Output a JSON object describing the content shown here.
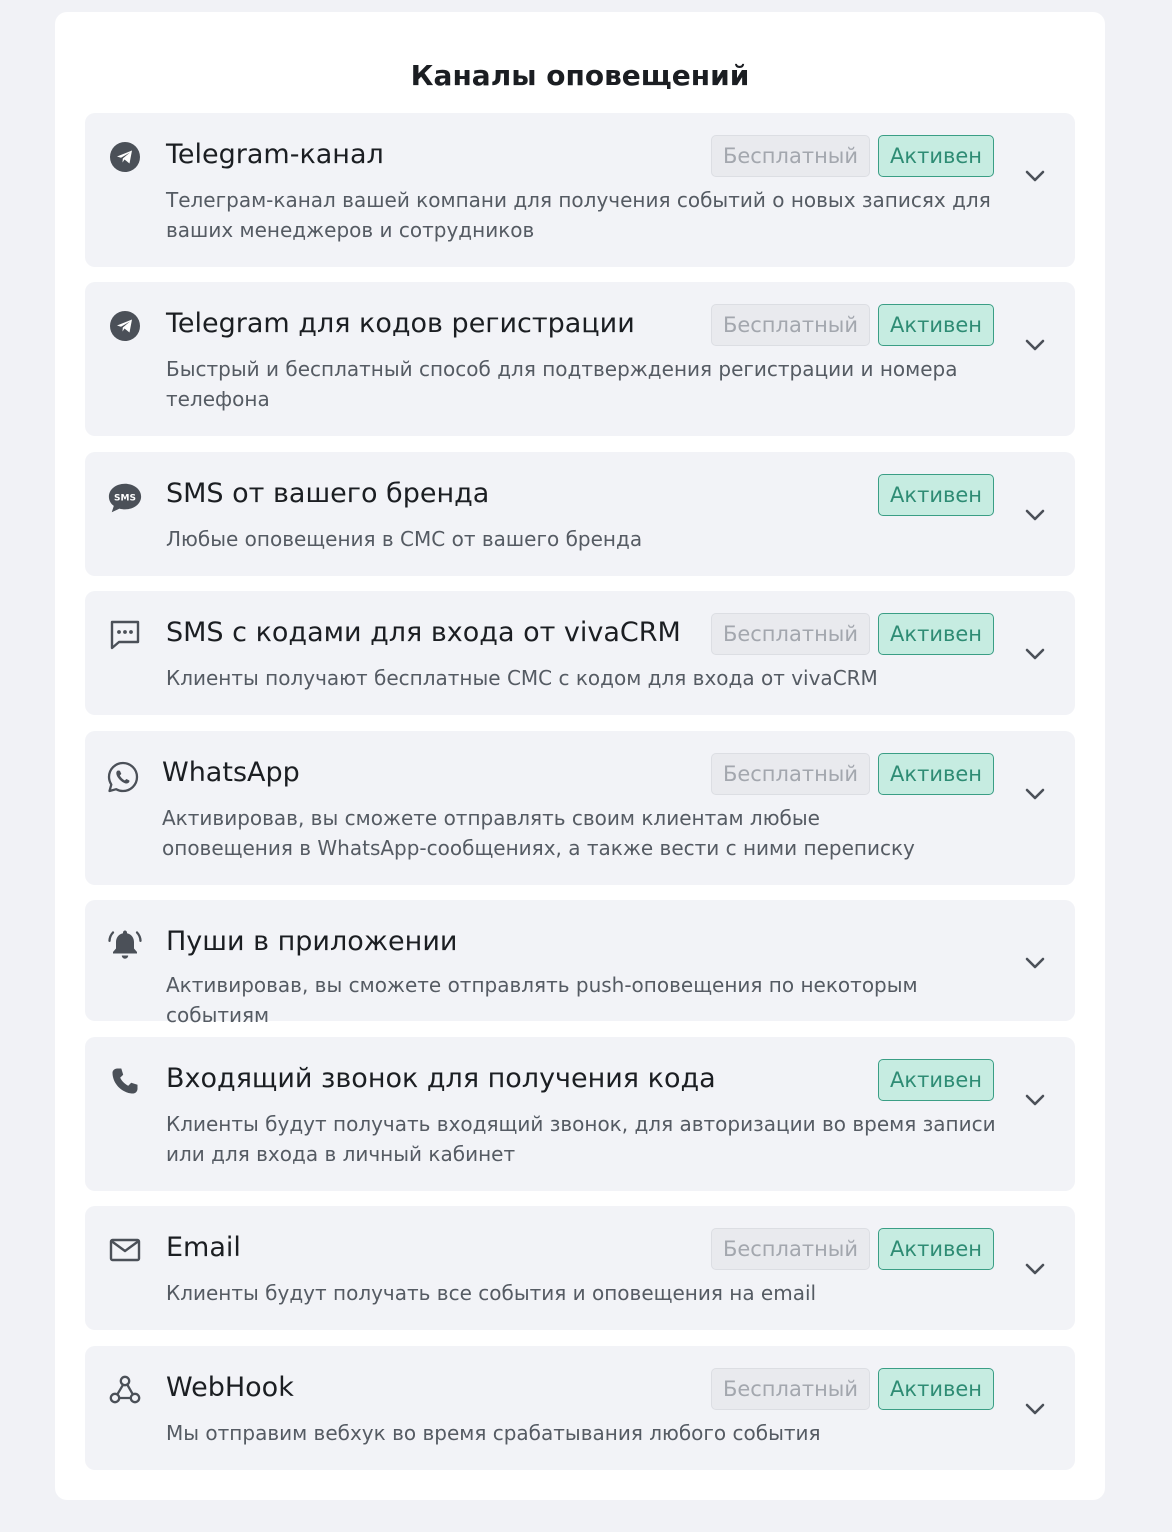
{
  "title": "Каналы оповещений",
  "badges": {
    "free": "Бесплатный",
    "active": "Активен"
  },
  "colors": {
    "active_bg": "#c6ece1",
    "active_border": "#3a9e85",
    "card_bg": "#f2f3f7",
    "icon": "#4b5058"
  },
  "channels": [
    {
      "icon": "telegram-icon",
      "title": "Telegram-канал",
      "description": "Телеграм-канал вашей компани для получения событий о новых записях для ваших менеджеров и сотрудников",
      "free": true,
      "active": true
    },
    {
      "icon": "telegram-icon",
      "title": "Telegram для кодов регистрации",
      "description": "Быстрый и бесплатный способ для подтверждения регистрации и номера телефона",
      "free": true,
      "active": true
    },
    {
      "icon": "sms-bubble-icon",
      "title": "SMS от вашего бренда",
      "description": "Любые оповещения в СМС от вашего бренда",
      "free": false,
      "active": true
    },
    {
      "icon": "message-dots-icon",
      "title": "SMS с кодами для входа от vivaCRM",
      "description": "Клиенты получают бесплатные СМС с кодом для входа от vivaCRM",
      "free": true,
      "active": true
    },
    {
      "icon": "whatsapp-icon",
      "title": "WhatsApp",
      "description": "Активировав, вы сможете отправлять своим клиентам любые оповещения в WhatsApp-сообщениях, а также вести с ними переписку",
      "free": true,
      "active": true
    },
    {
      "icon": "bell-ringing-icon",
      "title": "Пуши в приложении",
      "description": "Активировав, вы сможете отправлять push-оповещения по некоторым событиям",
      "free": false,
      "active": false
    },
    {
      "icon": "phone-icon",
      "title": "Входящий звонок для получения кода",
      "description": "Клиенты будут получать входящий звонок, для авторизации во время записи или для входа в личный кабинет",
      "free": false,
      "active": true
    },
    {
      "icon": "email-icon",
      "title": "Email",
      "description": "Клиенты будут получать все события и оповещения на email",
      "free": true,
      "active": true
    },
    {
      "icon": "webhook-icon",
      "title": "WebHook",
      "description": "Мы отправим вебхук во время срабатывания любого события",
      "free": true,
      "active": true
    }
  ]
}
